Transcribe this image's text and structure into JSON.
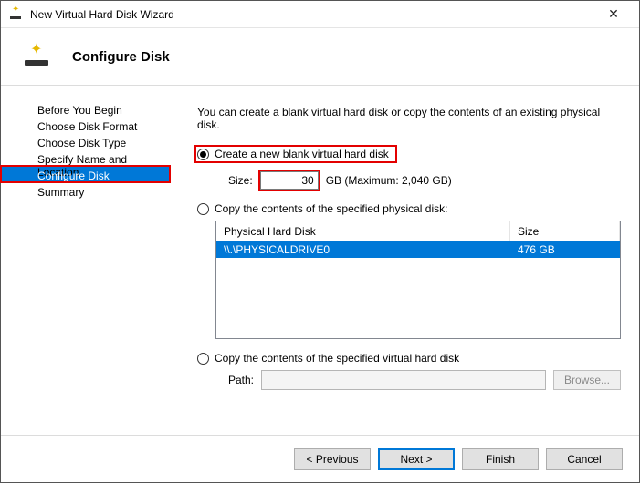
{
  "window": {
    "title": "New Virtual Hard Disk Wizard"
  },
  "page": {
    "heading": "Configure Disk"
  },
  "nav": {
    "items": [
      {
        "label": "Before You Begin"
      },
      {
        "label": "Choose Disk Format"
      },
      {
        "label": "Choose Disk Type"
      },
      {
        "label": "Specify Name and Location"
      },
      {
        "label": "Configure Disk",
        "active": true
      },
      {
        "label": "Summary"
      }
    ]
  },
  "content": {
    "intro": "You can create a blank virtual hard disk or copy the contents of an existing physical disk.",
    "option_blank": {
      "label": "Create a new blank virtual hard disk",
      "selected": true,
      "size_label": "Size:",
      "size_value": "30",
      "size_suffix": "GB (Maximum: 2,040 GB)"
    },
    "option_physical": {
      "label": "Copy the contents of the specified physical disk:",
      "selected": false,
      "col_name": "Physical Hard Disk",
      "col_size": "Size",
      "rows": [
        {
          "name": "\\\\.\\PHYSICALDRIVE0",
          "size": "476 GB",
          "selected": true
        }
      ]
    },
    "option_virtual": {
      "label": "Copy the contents of the specified virtual hard disk",
      "selected": false,
      "path_label": "Path:",
      "path_value": "",
      "browse_label": "Browse..."
    }
  },
  "footer": {
    "previous": "< Previous",
    "next": "Next >",
    "finish": "Finish",
    "cancel": "Cancel"
  }
}
